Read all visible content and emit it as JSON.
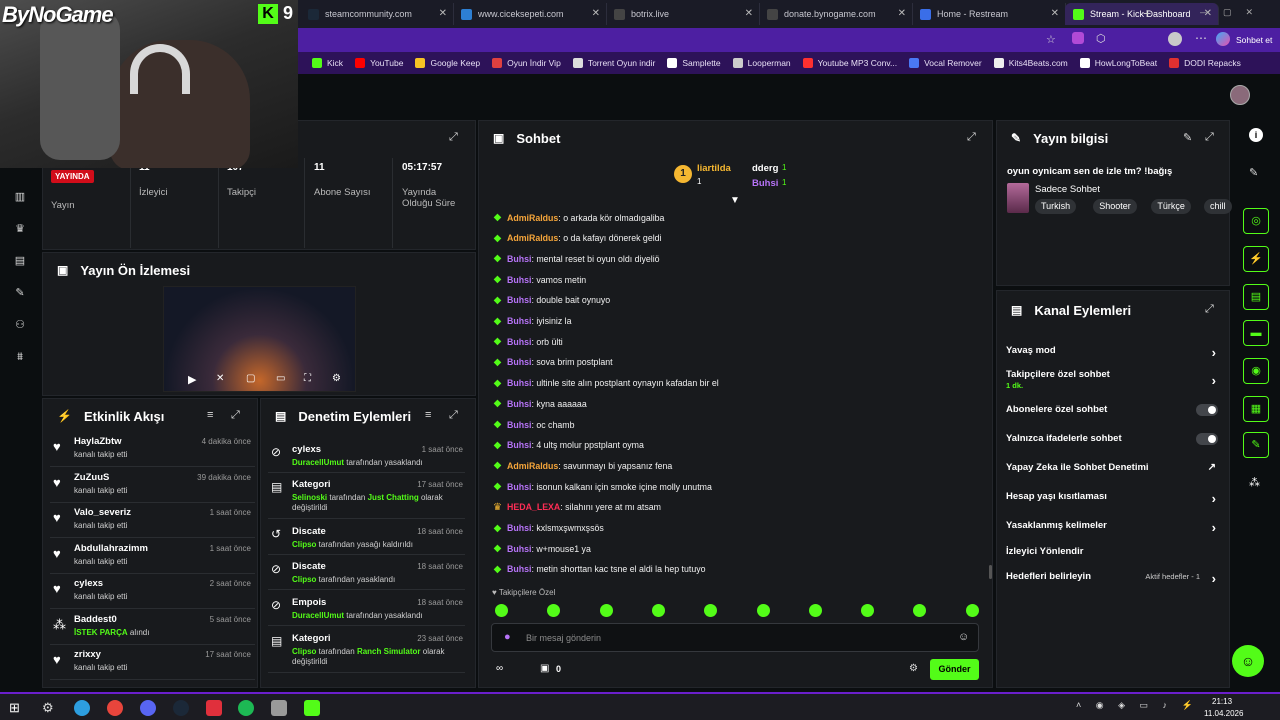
{
  "overlay": {
    "brand": "ByNoGame",
    "kick_mark": "9"
  },
  "browser": {
    "tabs": [
      {
        "title": "steamcommunity.com",
        "icon": "steam-icon"
      },
      {
        "title": "www.ciceksepeti.com",
        "icon": "globe-icon"
      },
      {
        "title": "botrix.live",
        "icon": "globe-icon"
      },
      {
        "title": "donate.bynogame.com",
        "icon": "globe-icon"
      },
      {
        "title": "Home - Restream",
        "icon": "restream-icon"
      },
      {
        "title": "Stream - Kick Dashboard",
        "icon": "kick-icon"
      }
    ],
    "profile_label": "Sohbet et",
    "bookmarks": [
      "Kick",
      "YouTube",
      "Google Keep",
      "Oyun İndir Vip",
      "Torrent Oyun indir",
      "Samplette",
      "Looperman",
      "Youtube MP3 Conv...",
      "Vocal Remover",
      "Kits4Beats.com",
      "HowLongToBeat",
      "DODI Repacks"
    ],
    "colors": {
      "accent": "#53fc18",
      "chrome": "#4d1fa2"
    }
  },
  "stats": {
    "live_badge": "YAYINDA",
    "live_label": "Yayın",
    "viewers_value": "11",
    "viewers_label": "İzleyici",
    "followers_value": "107",
    "followers_label": "Takipçi",
    "subs_value": "11",
    "subs_label": "Abone Sayısı",
    "uptime_value": "05:17:57",
    "uptime_label1": "Yayında",
    "uptime_label2": "Olduğu Süre"
  },
  "preview": {
    "title": "Yayın Ön İzlemesi"
  },
  "activity": {
    "title": "Etkinlik Akışı",
    "items": [
      {
        "name": "HaylaZbtw",
        "desc": "kanalı takip etti",
        "time": "4 dakika önce",
        "icon": "heart-icon"
      },
      {
        "name": "ZuZuuS",
        "desc": "kanalı takip etti",
        "time": "39 dakika önce",
        "icon": "heart-icon"
      },
      {
        "name": "Valo_severiz",
        "desc": "kanalı takip etti",
        "time": "1 saat önce",
        "icon": "heart-icon"
      },
      {
        "name": "Abdullahrazimm",
        "desc": "kanalı takip etti",
        "time": "1 saat önce",
        "icon": "heart-icon"
      },
      {
        "name": "cylexs",
        "desc": "kanalı takip etti",
        "time": "2 saat önce",
        "icon": "heart-icon"
      },
      {
        "name": "Baddest0",
        "desc_green": "İSTEK PARÇA",
        "desc": " alındı",
        "time": "5 saat önce",
        "icon": "points-icon"
      },
      {
        "name": "zrixxy",
        "desc": "kanalı takip etti",
        "time": "17 saat önce",
        "icon": "heart-icon"
      }
    ]
  },
  "moderation": {
    "title": "Denetim Eylemleri",
    "items": [
      {
        "name": "cylexs",
        "actor": "DuracellUmut",
        "text": " tarafından yasaklandı",
        "time": "1 saat önce",
        "icon": "ban-icon"
      },
      {
        "name": "Kategori",
        "actor": "Selinoski",
        "text": " tarafından ",
        "extra": "Just Chatting",
        "text2": " olarak değiştirildi",
        "time": "17 saat önce",
        "icon": "category-icon"
      },
      {
        "name": "Discate",
        "actor": "Clipso",
        "text": " tarafından yasağı kaldırıldı",
        "time": "18 saat önce",
        "icon": "unban-icon"
      },
      {
        "name": "Discate",
        "actor": "Clipso",
        "text": " tarafından yasaklandı",
        "time": "18 saat önce",
        "icon": "ban-icon"
      },
      {
        "name": "Empois",
        "actor": "DuracellUmut",
        "text": " tarafından yasaklandı",
        "time": "18 saat önce",
        "icon": "ban-icon"
      },
      {
        "name": "Kategori",
        "actor": "Clipso",
        "text": " tarafından ",
        "extra": "Ranch Simulator",
        "text2": " olarak değiştirildi",
        "time": "23 saat önce",
        "icon": "category-icon"
      }
    ]
  },
  "chat": {
    "title": "Sohbet",
    "leaders": [
      {
        "name": "liartilda",
        "count": "1"
      },
      {
        "name": "dderg",
        "count": "1"
      },
      {
        "name": "Buhsi",
        "count": "1"
      }
    ],
    "messages": [
      {
        "user": "AdmiRaldus",
        "cls": "u-admi",
        "text": ": o arkada kör olmadıgaliba",
        "badge": "sub-badge-icon"
      },
      {
        "user": "AdmiRaldus",
        "cls": "u-admi",
        "text": ": o da kafayı dönerek geldi",
        "badge": "sub-badge-icon"
      },
      {
        "user": "Buhsi",
        "cls": "u-buhsi",
        "text": ": mental reset bi oyun oldı diyeliö",
        "badge": "sub-badge-icon"
      },
      {
        "user": "Buhsi",
        "cls": "u-buhsi",
        "text": ": vamos metin",
        "badge": "sub-badge-icon"
      },
      {
        "user": "Buhsi",
        "cls": "u-buhsi",
        "text": ": double bait oynuyo",
        "badge": "sub-badge-icon"
      },
      {
        "user": "Buhsi",
        "cls": "u-buhsi",
        "text": ": iyisiniz la",
        "badge": "sub-badge-icon"
      },
      {
        "user": "Buhsi",
        "cls": "u-buhsi",
        "text": ": orb ülti",
        "badge": "sub-badge-icon"
      },
      {
        "user": "Buhsi",
        "cls": "u-buhsi",
        "text": ": sova brim postplant",
        "badge": "sub-badge-icon"
      },
      {
        "user": "Buhsi",
        "cls": "u-buhsi",
        "text": ": ultinle site alın postplant oynayın kafadan bir el",
        "badge": "sub-badge-icon"
      },
      {
        "user": "Buhsi",
        "cls": "u-buhsi",
        "text": ": kyna aaaaaa",
        "badge": "sub-badge-icon"
      },
      {
        "user": "Buhsi",
        "cls": "u-buhsi",
        "text": ": oc chamb",
        "badge": "sub-badge-icon"
      },
      {
        "user": "Buhsi",
        "cls": "u-buhsi",
        "text": ": 4 ultş molur ppstplant oyma",
        "badge": "sub-badge-icon"
      },
      {
        "user": "AdmiRaldus",
        "cls": "u-admi",
        "text": ": savunmayı bi yapsanız fena",
        "badge": "sub-badge-icon"
      },
      {
        "user": "Buhsi",
        "cls": "u-buhsi",
        "text": ": isonun kalkanı için smoke içine molly unutma",
        "badge": "sub-badge-icon"
      },
      {
        "user": "HEDA_LEXA",
        "cls": "u-heda",
        "text": ": silahını yere at mı atsam",
        "badge": "crown-icon"
      },
      {
        "user": "Buhsi",
        "cls": "u-buhsi",
        "text": ": kxlsmxşwmxşsös",
        "badge": "sub-badge-icon"
      },
      {
        "user": "Buhsi",
        "cls": "u-buhsi",
        "text": ": w+mouse1 ya",
        "badge": "sub-badge-icon"
      },
      {
        "user": "Buhsi",
        "cls": "u-buhsi",
        "text": ": metin shorttan kac tsne el aldi la hep tutuyo",
        "badge": "sub-badge-icon"
      }
    ],
    "emote_tab": "Takipçilere Özel",
    "placeholder": "Bir mesaj gönderin",
    "points": "0",
    "send": "Gönder"
  },
  "info": {
    "title": "Yayın bilgisi",
    "stream_title": "oyun oynicam sen de izle tm? !bağış",
    "category": "Sadece Sohbet",
    "tags": [
      "Turkish",
      "Shooter",
      "Türkçe",
      "chill"
    ]
  },
  "actions": {
    "title": "Kanal Eylemleri",
    "items": [
      {
        "label": "Yavaş mod",
        "kind": "chevron"
      },
      {
        "label": "Takipçilere özel sohbet",
        "sub": "1 dk.",
        "kind": "chevron"
      },
      {
        "label": "Abonelere özel sohbet",
        "kind": "toggle"
      },
      {
        "label": "Yalnızca ifadelerle sohbet",
        "kind": "toggle"
      },
      {
        "label": "Yapay Zeka ile Sohbet Denetimi",
        "kind": "external"
      },
      {
        "label": "Hesap yaşı kısıtlaması",
        "kind": "chevron"
      },
      {
        "label": "Yasaklanmış kelimeler",
        "kind": "chevron"
      },
      {
        "label": "İzleyici Yönlendir",
        "kind": "none"
      },
      {
        "label": "Hedefleri belirleyin",
        "note": "Aktif hedefler - 1",
        "kind": "chevron"
      }
    ]
  },
  "clock": {
    "time": "21:13",
    "date": "11.04.2026"
  }
}
